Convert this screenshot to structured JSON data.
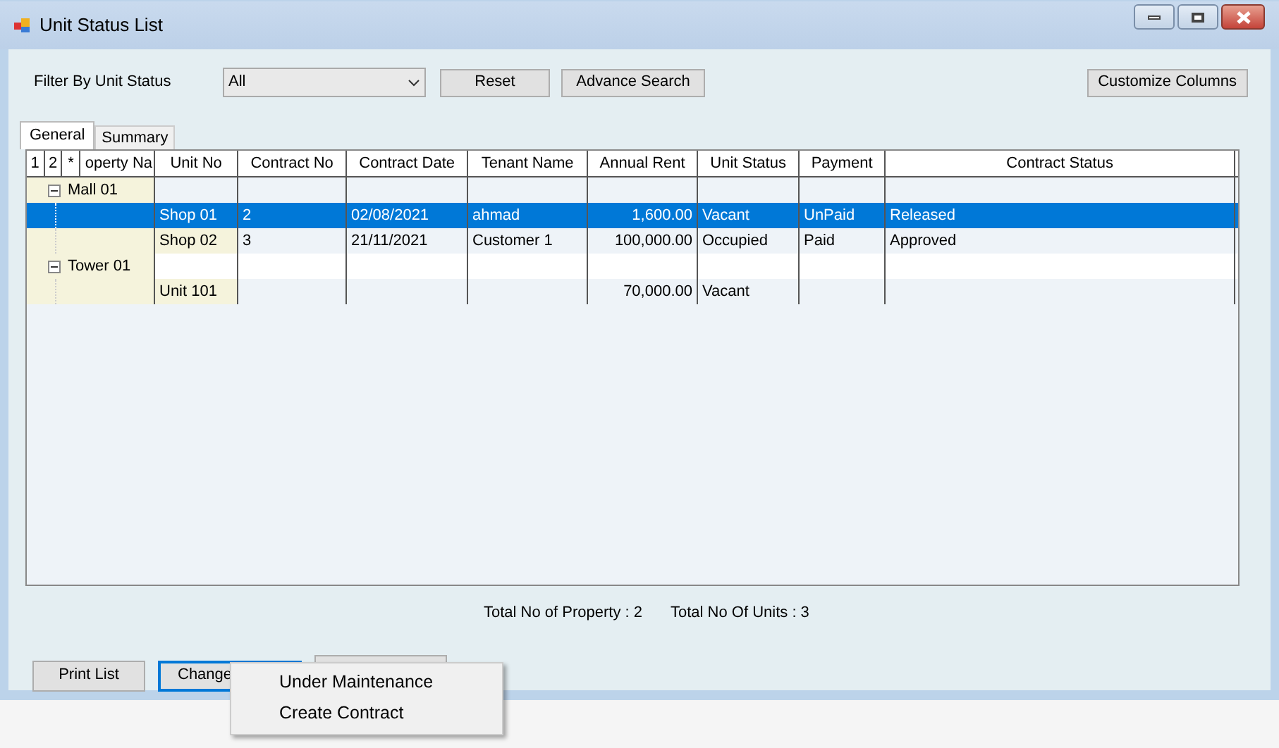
{
  "window": {
    "title": "Unit Status List"
  },
  "filter": {
    "label": "Filter By Unit Status",
    "value": "All"
  },
  "top_buttons": [
    "Reset",
    "Advance Search"
  ],
  "customize_button": "Customize Columns",
  "tabs": [
    {
      "label": "General",
      "selected": true
    },
    {
      "label": "Summary",
      "selected": false
    }
  ],
  "grid": {
    "group_levels": [
      "1",
      "2",
      "*"
    ],
    "columns": [
      "operty Na",
      "Unit No",
      "Contract No",
      "Contract Date",
      "Tenant Name",
      "Annual Rent",
      "Unit Status",
      "Payment",
      "Contract Status"
    ],
    "groups": [
      {
        "label": "Mall 01",
        "expanded": true,
        "children": [
          {
            "unit_no": "Shop 01",
            "contract_no": "2",
            "contract_date": "02/08/2021",
            "tenant_name": "ahmad",
            "annual_rent": "1,600.00",
            "unit_status": "Vacant",
            "payment": "UnPaid",
            "contract_status": "Released",
            "selected": true
          },
          {
            "unit_no": "Shop 02",
            "contract_no": "3",
            "contract_date": "21/11/2021",
            "tenant_name": "Customer 1",
            "annual_rent": "100,000.00",
            "unit_status": "Occupied",
            "payment": "Paid",
            "contract_status": "Approved",
            "selected": false
          }
        ]
      },
      {
        "label": "Tower 01",
        "expanded": true,
        "children": [
          {
            "unit_no": "Unit 101",
            "annual_rent": "70,000.00",
            "unit_status": "Vacant",
            "selected": false
          }
        ]
      }
    ]
  },
  "totals": [
    "Total No of Property : 2",
    "Total No Of Units : 3"
  ],
  "bottom_buttons": [
    {
      "label": "Print List",
      "focused": false
    },
    {
      "label": "Change",
      "focused": true
    },
    {
      "focused": false
    }
  ],
  "context_menu": [
    "Under Maintenance",
    "Create Contract"
  ]
}
